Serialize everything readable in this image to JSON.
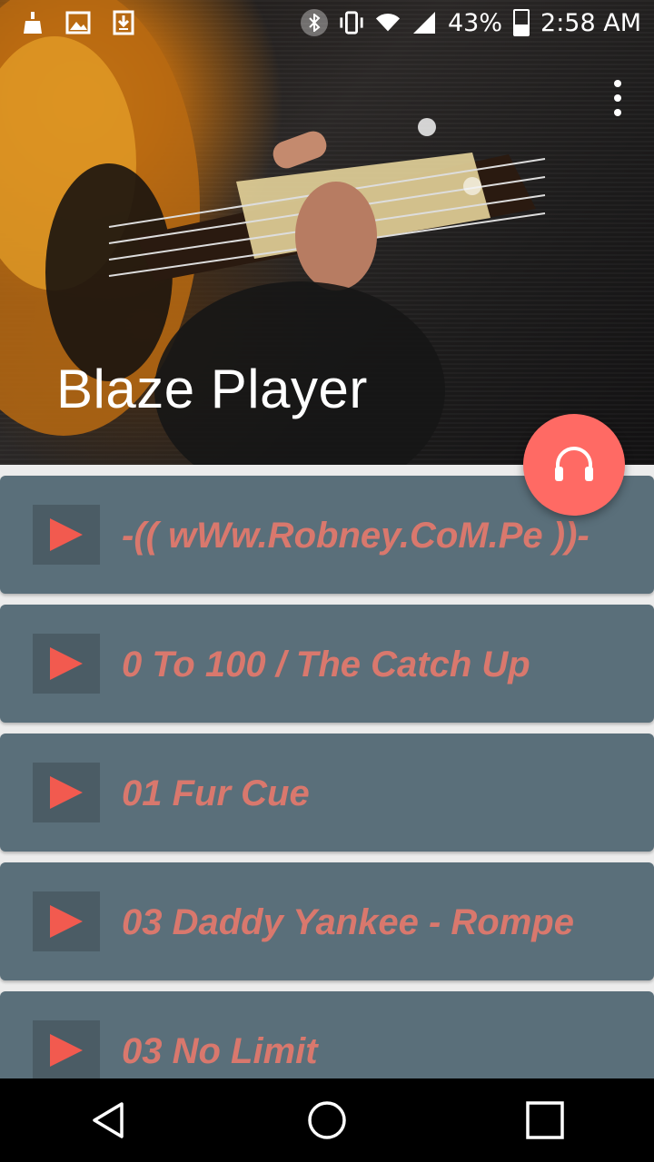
{
  "status_bar": {
    "battery_percent": "43%",
    "time": "2:58 AM",
    "left_icons": [
      "cleaner-icon",
      "image-icon",
      "download-icon"
    ],
    "right_icons": [
      "bluetooth-icon",
      "vibrate-icon",
      "wifi-icon",
      "signal-icon",
      "battery-icon"
    ]
  },
  "header": {
    "title": "Blaze Player"
  },
  "fab": {
    "icon": "headphones-icon",
    "color": "#ff6a64"
  },
  "songs": [
    {
      "title": "-(( wWw.Robney.CoM.Pe ))-"
    },
    {
      "title": "0 To 100 / The Catch Up"
    },
    {
      "title": "01 Fur Cue"
    },
    {
      "title": "03 Daddy Yankee - Rompe"
    },
    {
      "title": "03 No Limit"
    }
  ],
  "colors": {
    "row_bg": "#5a6f7a",
    "play_bg": "#4b5c65",
    "play_icon": "#f25a4f",
    "label": "#d9786d"
  },
  "nav": [
    "back-icon",
    "home-icon",
    "recents-icon"
  ]
}
